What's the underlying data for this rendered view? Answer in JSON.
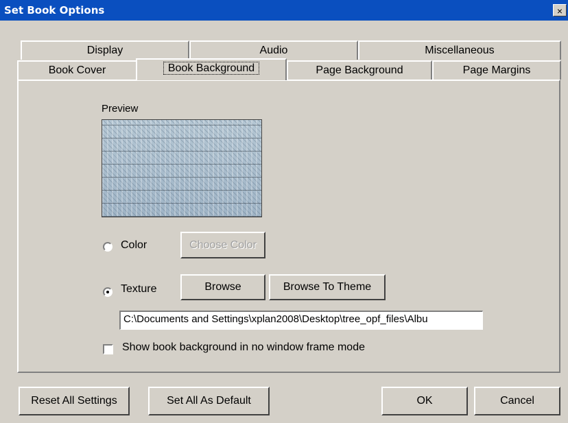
{
  "window": {
    "title": "Set Book Options",
    "close_glyph": "×"
  },
  "tabs_back": [
    "Display",
    "Audio",
    "Miscellaneous"
  ],
  "tabs_front": [
    "Book Cover",
    "Book Background",
    "Page Background",
    "Page Margins"
  ],
  "active_tab": "Book Background",
  "preview_label": "Preview",
  "color_option": {
    "label": "Color",
    "selected": false,
    "button": "Choose Color"
  },
  "texture_option": {
    "label": "Texture",
    "selected": true,
    "browse_button": "Browse",
    "theme_button": "Browse To Theme"
  },
  "texture_path": "C:\\Documents and Settings\\xplan2008\\Desktop\\tree_opf_files\\Albu",
  "show_background_checkbox": {
    "label": "Show book background in no window frame mode",
    "checked": false
  },
  "footer": {
    "reset": "Reset All Settings",
    "set_default": "Set All As Default",
    "ok": "OK",
    "cancel": "Cancel"
  },
  "colors": {
    "titlebar": "#0a4fbf",
    "face": "#d4d0c8"
  }
}
